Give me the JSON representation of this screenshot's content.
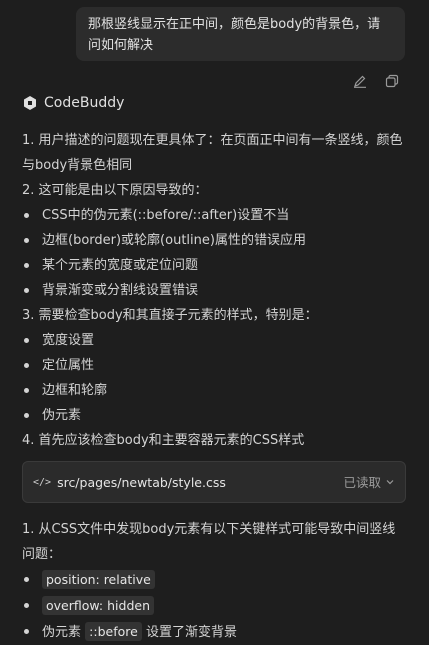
{
  "user_message": "那根竖线显示在正中间，颜色是body的背景色，请问如何解决",
  "actions": {
    "edit_icon": "edit-icon",
    "copy_icon": "copy-icon"
  },
  "assistant": {
    "name": "CodeBuddy",
    "logo": "codebuddy-logo"
  },
  "lines": {
    "l1": "1. 用户描述的问题现在更具体了：在页面正中间有一条竖线，颜色与body背景色相同",
    "l2": "2. 这可能是由以下原因导致的：",
    "b2": [
      "CSS中的伪元素(::before/::after)设置不当",
      "边框(border)或轮廓(outline)属性的错误应用",
      "某个元素的宽度或定位问题",
      "背景渐变或分割线设置错误"
    ],
    "l3": "3. 需要检查body和其直接子元素的样式，特别是：",
    "b3": [
      "宽度设置",
      "定位属性",
      "边框和轮廓",
      "伪元素"
    ],
    "l4": "4. 首先应该检查body和主要容器元素的CSS样式"
  },
  "file": {
    "path": "src/pages/newtab/style.css",
    "status": "已读取"
  },
  "after": {
    "l5": "1. 从CSS文件中发现body元素有以下关键样式可能导致中间竖线问题：",
    "c1": "position: relative",
    "c2": "overflow: hidden",
    "c3_prefix": "伪元素",
    "c3_code": "::before",
    "c3_suffix": "设置了渐变背景"
  }
}
